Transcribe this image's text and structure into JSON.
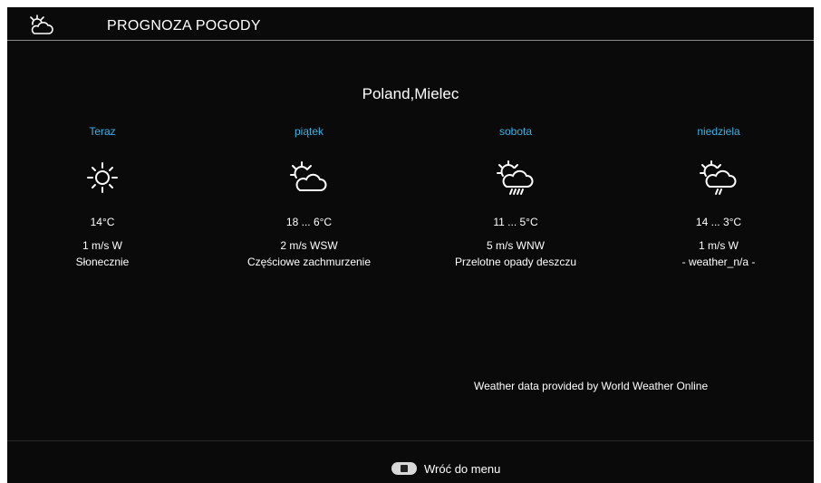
{
  "header": {
    "title": "PROGNOZA POGODY",
    "icon": "weather-app-icon"
  },
  "location": "Poland,Mielec",
  "days": [
    {
      "name": "Teraz",
      "icon": "sun-icon",
      "temp": "14°C",
      "wind": "1 m/s W",
      "desc": "Słonecznie"
    },
    {
      "name": "piątek",
      "icon": "partly-cloudy-icon",
      "temp": "18 ... 6°C",
      "wind": "2 m/s WSW",
      "desc": "Częściowe zachmurzenie"
    },
    {
      "name": "sobota",
      "icon": "sun-cloud-rain-icon",
      "temp": "11 ... 5°C",
      "wind": "5 m/s WNW",
      "desc": "Przelotne opady deszczu"
    },
    {
      "name": "niedziela",
      "icon": "sun-cloud-drizzle-icon",
      "temp": "14 ... 3°C",
      "wind": "1 m/s W",
      "desc": "- weather_n/a -"
    }
  ],
  "credit": "Weather data provided by World Weather Online",
  "footer": {
    "back_label": "Wróć do menu",
    "back_icon": "remote-button-icon"
  },
  "colors": {
    "background": "#0a0a0a",
    "day_label": "#35b4e6",
    "text": "#ffffff"
  }
}
